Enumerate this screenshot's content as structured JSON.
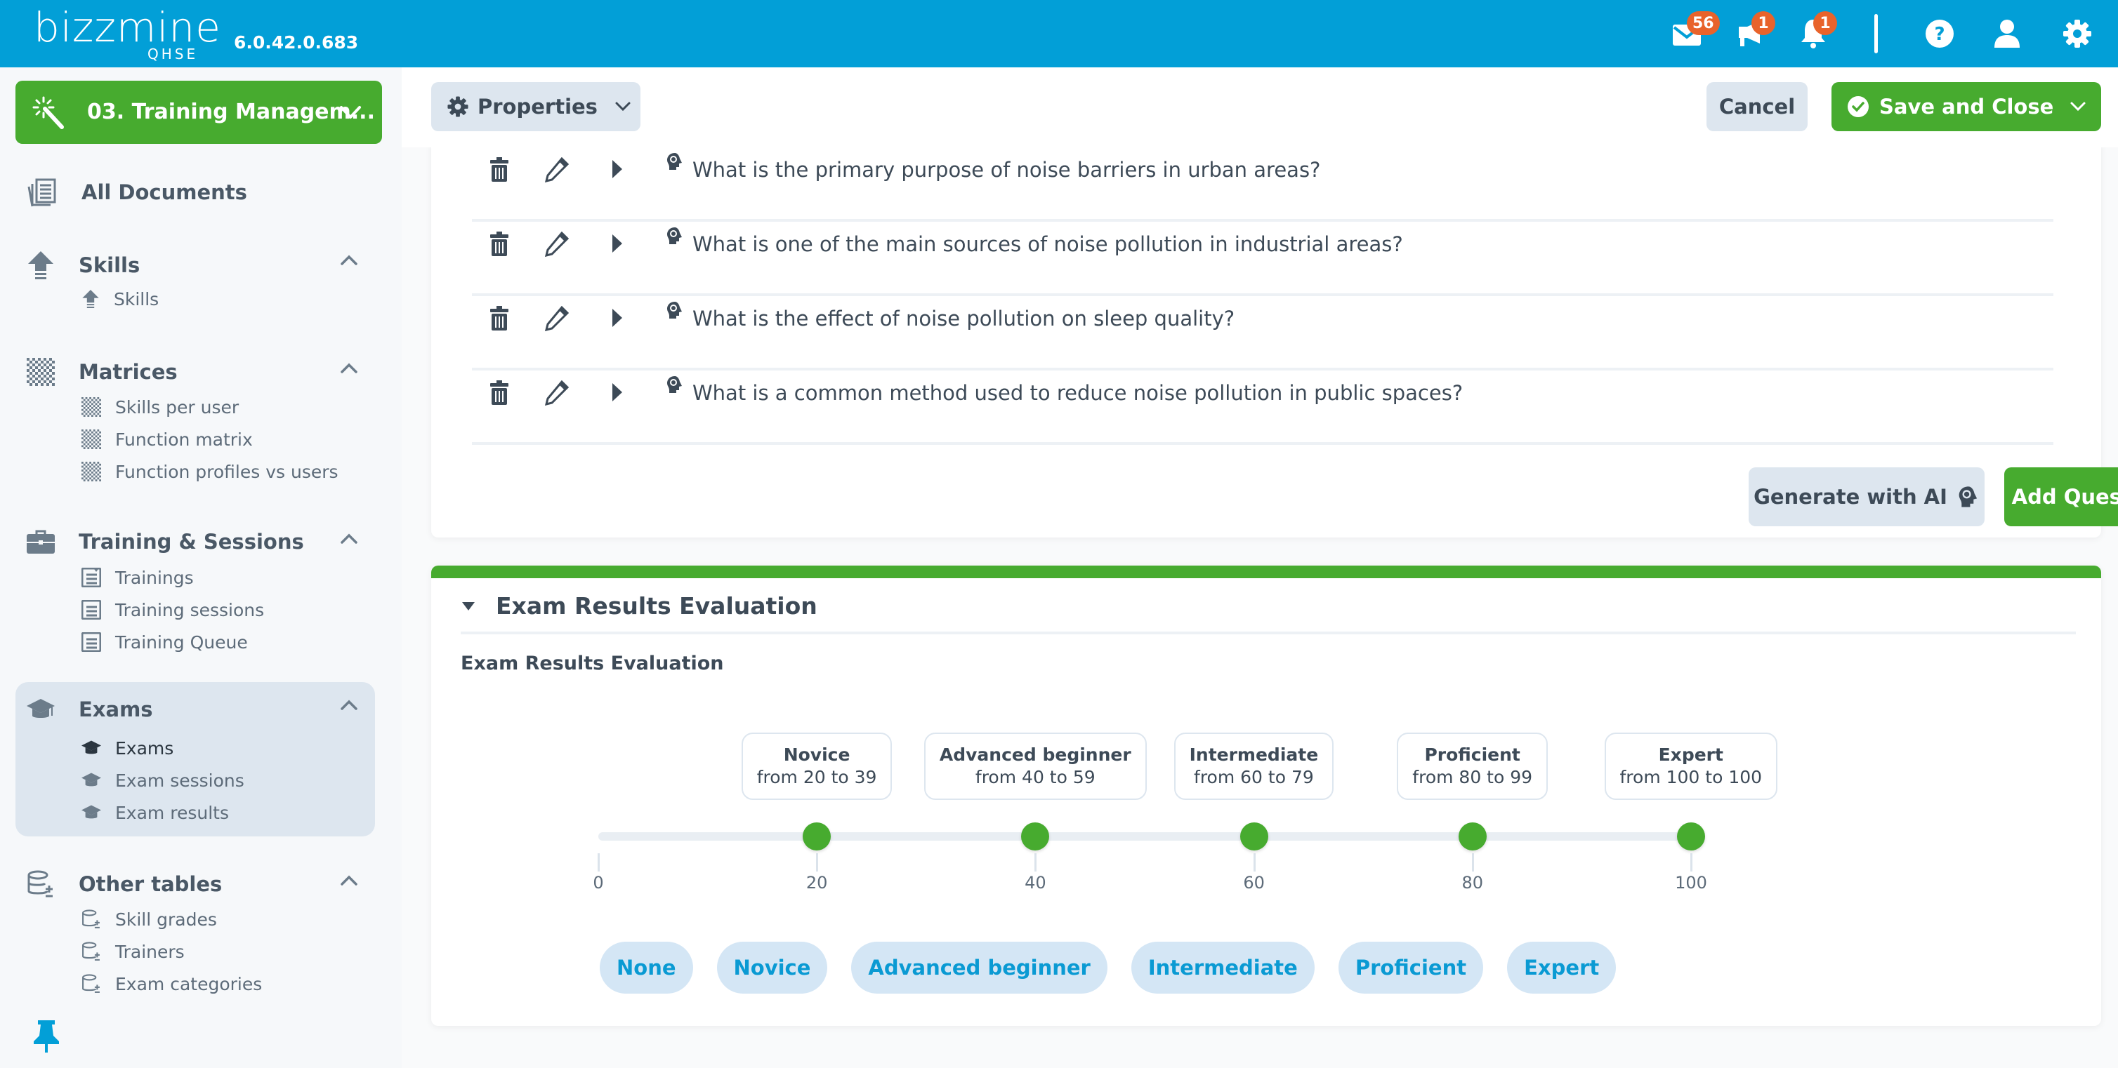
{
  "topbar": {
    "logo_word": "bizzmine",
    "logo_sub": "QHSE",
    "version": "6.0.42.0.683",
    "icons": [
      {
        "name": "mail-icon",
        "badge": "56"
      },
      {
        "name": "megaphone-icon",
        "badge": "1"
      },
      {
        "name": "bell-icon",
        "badge": "1"
      },
      {
        "name": "help-icon",
        "badge": null
      },
      {
        "name": "user-icon",
        "badge": null
      },
      {
        "name": "gear-icon",
        "badge": null
      }
    ],
    "colors": {
      "bar": "#029fd7",
      "badge": "#e8632b"
    }
  },
  "sidebar": {
    "app_selector": {
      "label": "03. Training Managem...",
      "icon": "magic-wand-icon"
    },
    "all_documents": {
      "label": "All Documents",
      "icon": "documents-icon"
    },
    "groups": [
      {
        "label": "Skills",
        "icon": "arrow-up-icon",
        "expanded": true,
        "items": [
          {
            "label": "Skills",
            "icon": "arrow-up-icon"
          }
        ]
      },
      {
        "label": "Matrices",
        "icon": "checkered-grid-icon",
        "expanded": true,
        "items": [
          {
            "label": "Skills per user",
            "icon": "checkered-grid-icon"
          },
          {
            "label": "Function matrix",
            "icon": "checkered-grid-icon"
          },
          {
            "label": "Function profiles vs users",
            "icon": "checkered-grid-icon"
          }
        ]
      },
      {
        "label": "Training & Sessions",
        "icon": "briefcase-icon",
        "expanded": true,
        "items": [
          {
            "label": "Trainings",
            "icon": "list-icon"
          },
          {
            "label": "Training sessions",
            "icon": "list-icon"
          },
          {
            "label": "Training Queue",
            "icon": "list-icon"
          }
        ]
      },
      {
        "label": "Exams",
        "icon": "graduation-cap-icon",
        "expanded": true,
        "active": true,
        "items": [
          {
            "label": "Exams",
            "icon": "graduation-cap-icon",
            "current": true
          },
          {
            "label": "Exam sessions",
            "icon": "graduation-cap-icon"
          },
          {
            "label": "Exam results",
            "icon": "graduation-cap-icon"
          }
        ]
      },
      {
        "label": "Other tables",
        "icon": "database-plus-icon",
        "expanded": true,
        "items": [
          {
            "label": "Skill grades",
            "icon": "database-plus-icon"
          },
          {
            "label": "Trainers",
            "icon": "database-plus-icon"
          },
          {
            "label": "Exam categories",
            "icon": "database-plus-icon"
          }
        ]
      }
    ],
    "pin_icon": "pin-icon"
  },
  "actionbar": {
    "properties_label": "Properties",
    "cancel_label": "Cancel",
    "save_label": "Save and Close"
  },
  "questions": {
    "items": [
      "What is the primary purpose of noise barriers in urban areas?",
      "What is one of the main sources of noise pollution in industrial areas?",
      "What is the effect of noise pollution on sleep quality?",
      "What is a common method used to reduce noise pollution in public spaces?"
    ],
    "generate_ai_label": "Generate with AI",
    "add_question_label": "Add Question"
  },
  "evaluation": {
    "section_title": "Exam Results Evaluation",
    "field_label": "Exam Results Evaluation",
    "scale": {
      "min": 0,
      "max": 100,
      "ticks": [
        "0",
        "20",
        "40",
        "60",
        "80",
        "100"
      ]
    },
    "levels": [
      {
        "name": "Novice",
        "from": 20,
        "to": 39,
        "range_label": "from 20 to 39"
      },
      {
        "name": "Advanced beginner",
        "from": 40,
        "to": 59,
        "range_label": "from 40 to 59"
      },
      {
        "name": "Intermediate",
        "from": 60,
        "to": 79,
        "range_label": "from 60 to 79"
      },
      {
        "name": "Proficient",
        "from": 80,
        "to": 99,
        "range_label": "from 80 to 99"
      },
      {
        "name": "Expert",
        "from": 100,
        "to": 100,
        "range_label": "from 100 to 100"
      }
    ],
    "chips": [
      "None",
      "Novice",
      "Advanced beginner",
      "Intermediate",
      "Proficient",
      "Expert"
    ],
    "colors": {
      "knob": "#47ab2f",
      "chip_bg": "#d4e6f5",
      "chip_text": "#0a9ad3"
    }
  }
}
